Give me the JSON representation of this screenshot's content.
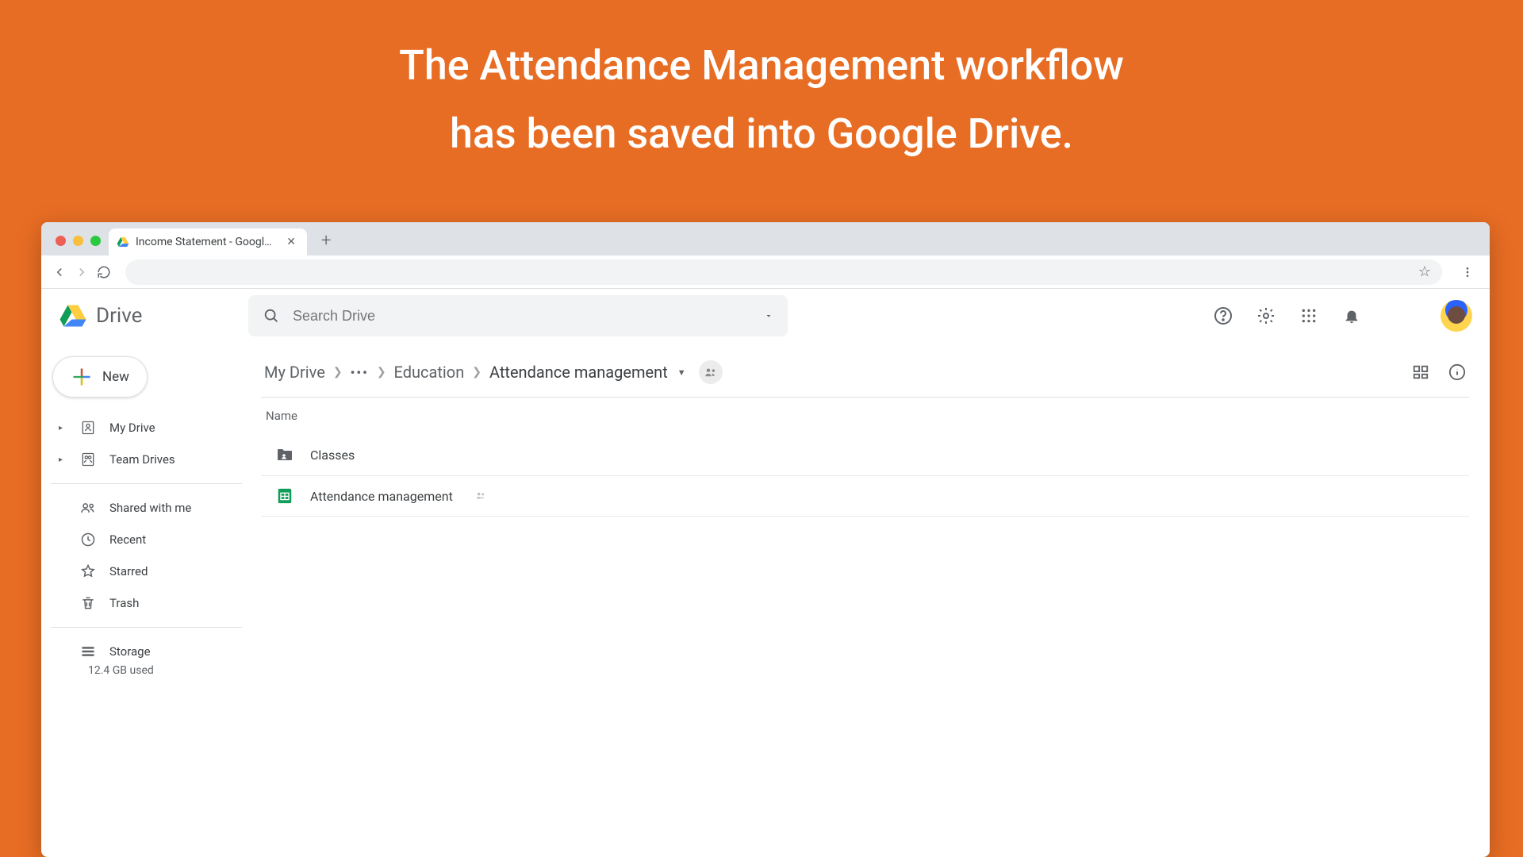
{
  "caption": {
    "line1": "The Attendance Management workflow",
    "line2": "has been saved into Google Drive."
  },
  "browser": {
    "tab_title": "Income Statement - Google Dr",
    "tab_icon": "drive-icon"
  },
  "drive": {
    "app_name": "Drive",
    "search_placeholder": "Search Drive",
    "new_button": "New",
    "sidebar": {
      "items": [
        {
          "label": "My Drive",
          "icon": "mydrive-icon",
          "expandable": true
        },
        {
          "label": "Team Drives",
          "icon": "teamdrives-icon",
          "expandable": true
        }
      ],
      "section2": [
        {
          "label": "Shared with me",
          "icon": "shared-icon"
        },
        {
          "label": "Recent",
          "icon": "recent-icon"
        },
        {
          "label": "Starred",
          "icon": "star-icon"
        },
        {
          "label": "Trash",
          "icon": "trash-icon"
        }
      ],
      "storage": {
        "label": "Storage",
        "used": "12.4 GB used"
      }
    },
    "breadcrumbs": {
      "root": "My Drive",
      "mid": "Education",
      "current": "Attendance management"
    },
    "column_header": "Name",
    "files": [
      {
        "name": "Classes",
        "type": "folder",
        "shared": true
      },
      {
        "name": "Attendance management",
        "type": "sheet",
        "shared": true
      }
    ]
  }
}
